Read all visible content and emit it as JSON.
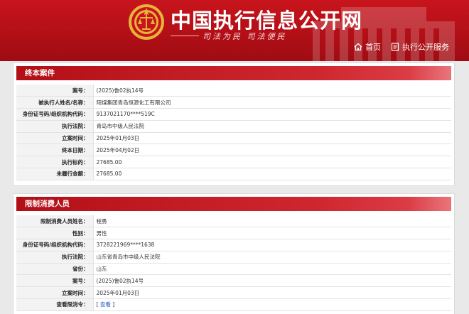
{
  "header": {
    "title": "中国执行信息公开网",
    "slogan": "司法为民    司法便民",
    "nav": [
      {
        "label": "首页",
        "icon": "home-icon"
      },
      {
        "label": "执行公开服务",
        "icon": "document-icon"
      }
    ]
  },
  "case_panel": {
    "title": "终本案件",
    "rows": [
      {
        "label": "案号：",
        "value": "(2025)鲁02执14号"
      },
      {
        "label": "被执行人姓名/名称：",
        "value": "阳煤集团青岛恒源化工有限公司"
      },
      {
        "label": "身份证号码/组织机构代码：",
        "value": "9137021170****519C"
      },
      {
        "label": "执行法院：",
        "value": "青岛市中级人民法院"
      },
      {
        "label": "立案时间：",
        "value": "2025年01月03日"
      },
      {
        "label": "终本日期：",
        "value": "2025年04月02日"
      },
      {
        "label": "执行标的：",
        "value": "27685.00"
      },
      {
        "label": "未履行金额：",
        "value": "27685.00"
      }
    ]
  },
  "restrict_panel": {
    "title": "限制消费人员",
    "rows": [
      {
        "label": "限制消费人员姓名：",
        "value": "程勇"
      },
      {
        "label": "性别：",
        "value": "男性"
      },
      {
        "label": "身份证号码/组织机构代码：",
        "value": "3728221969****1638"
      },
      {
        "label": "执行法院：",
        "value": "山东省青岛市中级人民法院"
      },
      {
        "label": "省份：",
        "value": "山东"
      },
      {
        "label": "案号：",
        "value": "(2025)鲁02执14号"
      },
      {
        "label": "立案时间：",
        "value": "2025年01月03日"
      },
      {
        "label": "查看限消令：",
        "value_prefix": "[",
        "value": "查看",
        "value_suffix": "]"
      }
    ]
  },
  "colors": {
    "brand_red": "#c8141c",
    "link_blue": "#1c55c4"
  }
}
